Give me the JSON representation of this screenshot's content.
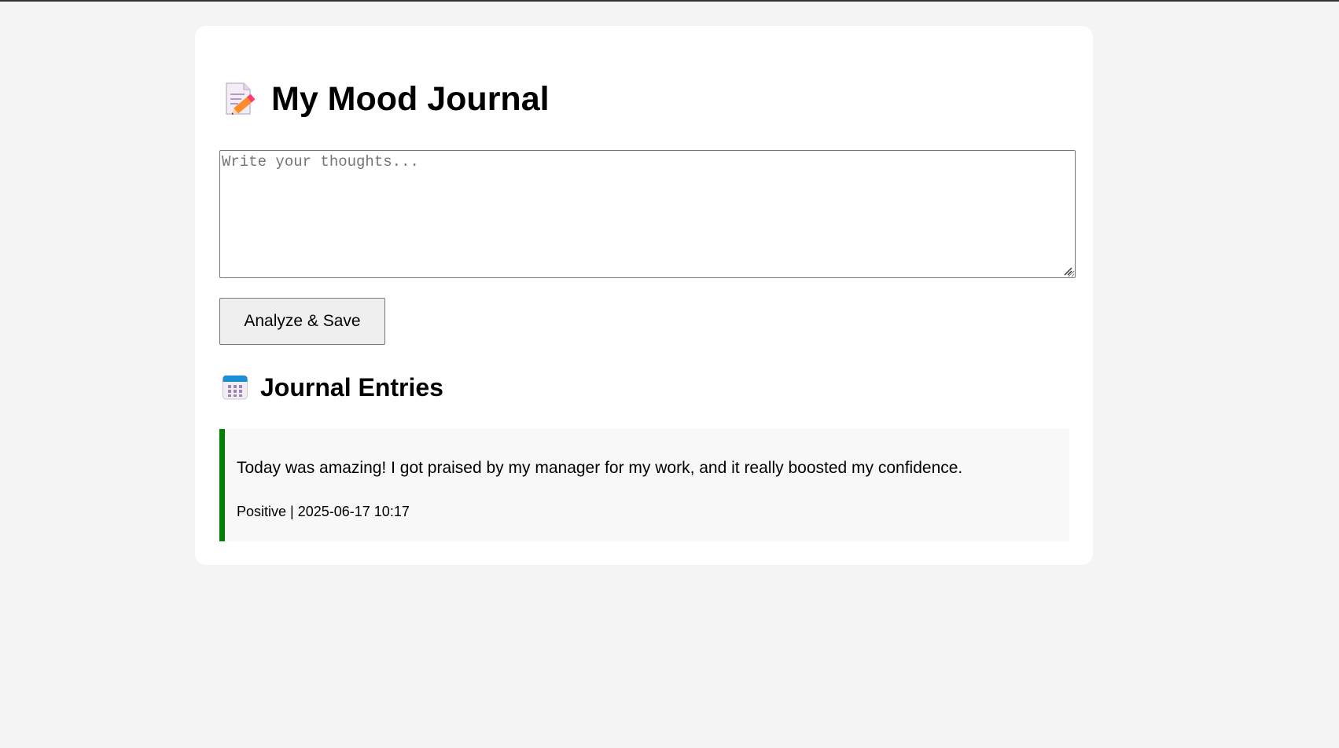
{
  "header": {
    "title": "My Mood Journal",
    "title_icon": "memo-pencil-icon"
  },
  "composer": {
    "value": "",
    "placeholder": "Write your thoughts...",
    "submit_label": "Analyze & Save"
  },
  "entries_section": {
    "title": "Journal Entries",
    "icon": "calendar-icon"
  },
  "entries": [
    {
      "text": "Today was amazing! I got praised by my manager for my work, and it really boosted my confidence.",
      "sentiment": "Positive",
      "separator": " | ",
      "timestamp": "2025-06-17 10:17",
      "accent_color": "#008000"
    }
  ],
  "colors": {
    "page_background": "#f4f4f4",
    "card_background": "#ffffff",
    "positive_accent": "#008000",
    "entry_background": "#f8f8f8"
  }
}
